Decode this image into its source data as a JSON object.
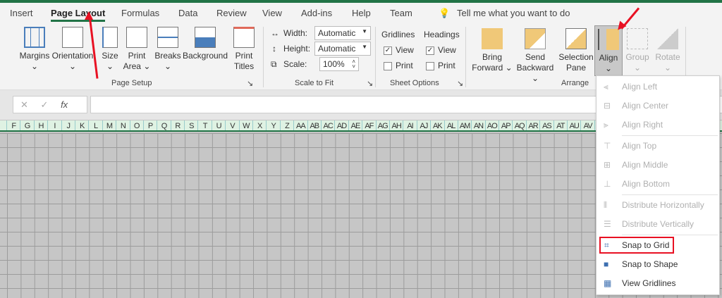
{
  "tabs": [
    "Insert",
    "Page Layout",
    "Formulas",
    "Data",
    "Review",
    "View",
    "Add-ins",
    "Help",
    "Team"
  ],
  "tell_me": "Tell me what you want to do",
  "page_setup": {
    "margins": "Margins",
    "orientation": "Orientation",
    "size": "Size",
    "print_area_1": "Print",
    "print_area_2": "Area",
    "breaks": "Breaks",
    "background": "Background",
    "print_titles_1": "Print",
    "print_titles_2": "Titles",
    "group": "Page Setup"
  },
  "scale_to_fit": {
    "width_label": "Width:",
    "width_value": "Automatic",
    "height_label": "Height:",
    "height_value": "Automatic",
    "scale_label": "Scale:",
    "scale_value": "100%",
    "group": "Scale to Fit"
  },
  "sheet_options": {
    "gridlines": "Gridlines",
    "headings": "Headings",
    "view": "View",
    "print": "Print",
    "group": "Sheet Options",
    "gridlines_view": true,
    "gridlines_print": false,
    "headings_view": true,
    "headings_print": false
  },
  "arrange": {
    "bring_1": "Bring",
    "bring_2": "Forward",
    "send_1": "Send",
    "send_2": "Backward",
    "sel_1": "Selection",
    "sel_2": "Pane",
    "align": "Align",
    "group_btn": "Group",
    "rotate": "Rotate",
    "group": "Arrange"
  },
  "formula_bar": {
    "cancel": "✕",
    "enter": "✓",
    "fx": "fx"
  },
  "columns": [
    "F",
    "G",
    "H",
    "I",
    "J",
    "K",
    "L",
    "M",
    "N",
    "O",
    "P",
    "Q",
    "R",
    "S",
    "T",
    "U",
    "V",
    "W",
    "X",
    "Y",
    "Z",
    "AA",
    "AB",
    "AC",
    "AD",
    "AE",
    "AF",
    "AG",
    "AH",
    "AI",
    "AJ",
    "AK",
    "AL",
    "AM",
    "AN",
    "AO",
    "AP",
    "AQ",
    "AR",
    "AS",
    "AT",
    "AU",
    "AV"
  ],
  "align_menu": [
    {
      "label": "Align Left",
      "enabled": false
    },
    {
      "label": "Align Center",
      "enabled": false
    },
    {
      "label": "Align Right",
      "enabled": false
    },
    {
      "label": "Align Top",
      "enabled": false
    },
    {
      "label": "Align Middle",
      "enabled": false
    },
    {
      "label": "Align Bottom",
      "enabled": false
    },
    {
      "label": "Distribute Horizontally",
      "enabled": false
    },
    {
      "label": "Distribute Vertically",
      "enabled": false
    },
    {
      "label": "Snap to Grid",
      "enabled": true
    },
    {
      "label": "Snap to Shape",
      "enabled": true
    },
    {
      "label": "View Gridlines",
      "enabled": true
    }
  ],
  "colors": {
    "accent": "#217346",
    "highlight": "#e81123"
  }
}
